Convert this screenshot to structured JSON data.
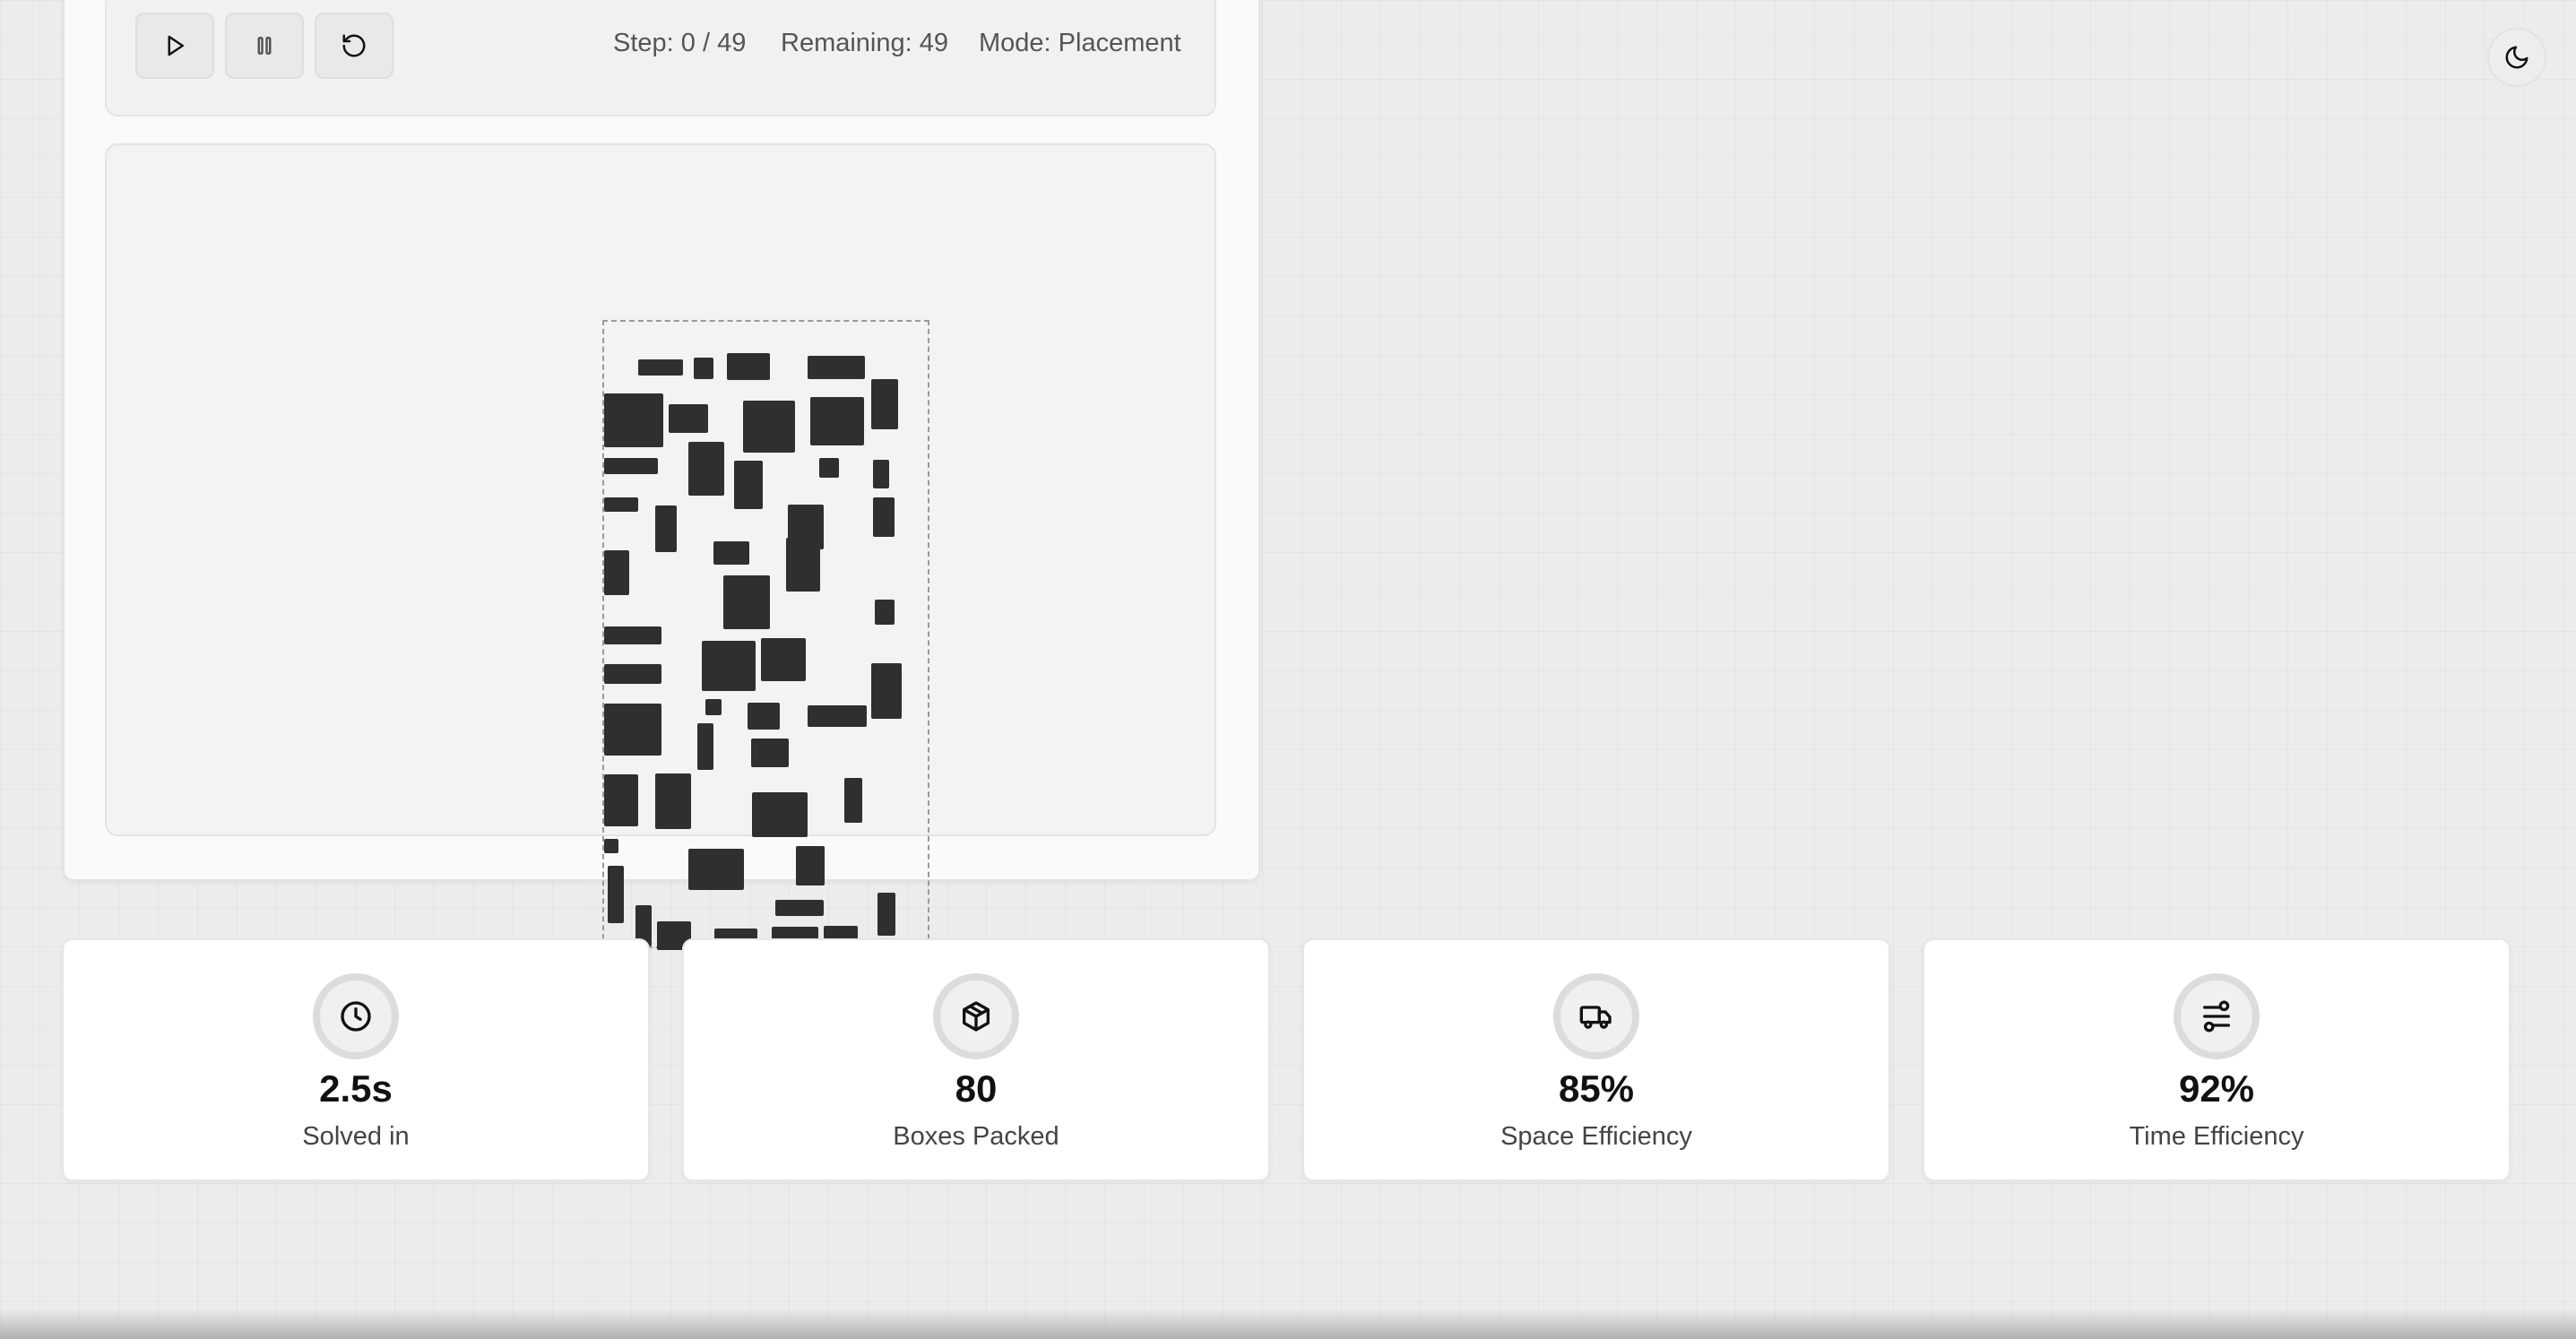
{
  "toolbar": {
    "play_icon": "play-icon",
    "pause_icon": "pause-icon",
    "reset_icon": "rotate-ccw-icon",
    "step": "Step: 0 / 49",
    "remaining": "Remaining: 49",
    "mode": "Mode: Placement"
  },
  "theme_toggle": {
    "icon": "moon-icon"
  },
  "stats": [
    {
      "icon": "clock-icon",
      "value": "2.5s",
      "label": "Solved in"
    },
    {
      "icon": "package-icon",
      "value": "80",
      "label": "Boxes Packed"
    },
    {
      "icon": "truck-icon",
      "value": "85%",
      "label": "Space Efficiency"
    },
    {
      "icon": "route-icon",
      "value": "92%",
      "label": "Time Efficiency"
    }
  ],
  "colors": {
    "box": "#2f2f2f",
    "card_bg": "#ffffff",
    "page_bg": "#ececec"
  }
}
